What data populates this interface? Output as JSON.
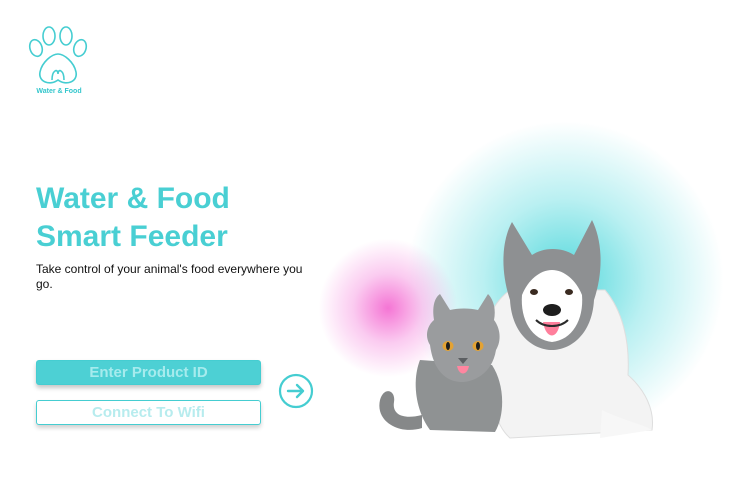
{
  "brand": {
    "name": "Water & Food",
    "accent_color": "#49cfd3"
  },
  "hero": {
    "title_line1": "Water & Food",
    "title_line2": "Smart Feeder",
    "subtitle": "Take control of your animal's food everywhere you go."
  },
  "actions": {
    "product_id_label": "Enter Product ID",
    "wifi_label": "Connect To Wifi",
    "next_icon": "arrow-right-circle-icon"
  },
  "illustration": {
    "subjects": [
      "cat",
      "husky-dog"
    ]
  }
}
